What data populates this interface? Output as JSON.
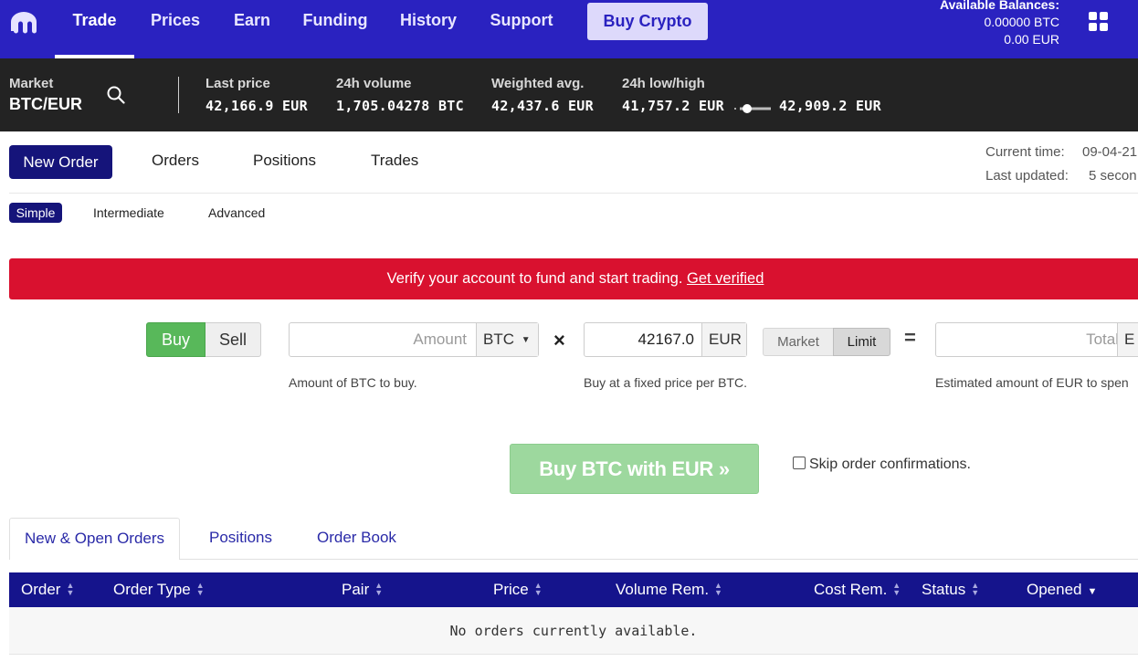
{
  "nav": {
    "items": [
      {
        "label": "Trade",
        "active": true
      },
      {
        "label": "Prices"
      },
      {
        "label": "Earn"
      },
      {
        "label": "Funding"
      },
      {
        "label": "History"
      },
      {
        "label": "Support"
      }
    ],
    "buy_crypto": "Buy Crypto",
    "balances": {
      "title": "Available Balances:",
      "btc": "0.00000 BTC",
      "eur": "0.00 EUR"
    },
    "logo_icon": "kraken-logo-icon",
    "apps_icon": "grid-icon"
  },
  "ticker": {
    "market_label": "Market",
    "pair": "BTC/EUR",
    "last_price_label": "Last price",
    "last_price": "42,166.9 EUR",
    "volume_label": "24h volume",
    "volume": "1,705.04278 BTC",
    "weighted_label": "Weighted avg.",
    "weighted": "42,437.6 EUR",
    "lowhigh_label": "24h low/high",
    "low": "41,757.2 EUR",
    "high": "42,909.2 EUR"
  },
  "order_tabs": {
    "new_order": "New Order",
    "orders": "Orders",
    "positions": "Positions",
    "trades": "Trades"
  },
  "time": {
    "current_label": "Current time:",
    "current_value": "09-04-21",
    "updated_label": "Last updated:",
    "updated_value": "5 secon"
  },
  "modes": {
    "simple": "Simple",
    "intermediate": "Intermediate",
    "advanced": "Advanced"
  },
  "verify": {
    "text": "Verify your account to fund and start trading.",
    "link": "Get verified"
  },
  "form": {
    "buy": "Buy",
    "sell": "Sell",
    "amount_placeholder": "Amount",
    "amount_currency": "BTC",
    "times": "×",
    "price_value": "42167.0",
    "price_currency": "EUR",
    "market": "Market",
    "limit": "Limit",
    "equals": "=",
    "total_placeholder": "Total",
    "total_currency": "E",
    "hint_amount": "Amount of BTC to buy.",
    "hint_price": "Buy at a fixed price per BTC.",
    "hint_total": "Estimated amount of EUR to spen",
    "submit": "Buy BTC with EUR »",
    "skip": "Skip order confirmations."
  },
  "lower_tabs": {
    "open_orders": "New & Open Orders",
    "positions": "Positions",
    "order_book": "Order Book"
  },
  "table": {
    "columns": [
      "Order",
      "Order Type",
      "Pair",
      "Price",
      "Volume Rem.",
      "Cost Rem.",
      "Status",
      "Opened"
    ],
    "empty": "No orders currently available."
  },
  "colors": {
    "nav_bg": "#2a22c0",
    "ticker_bg": "#232323",
    "accent_navy": "#15147a",
    "banner_red": "#d9112f",
    "buy_green": "#58b85a"
  }
}
